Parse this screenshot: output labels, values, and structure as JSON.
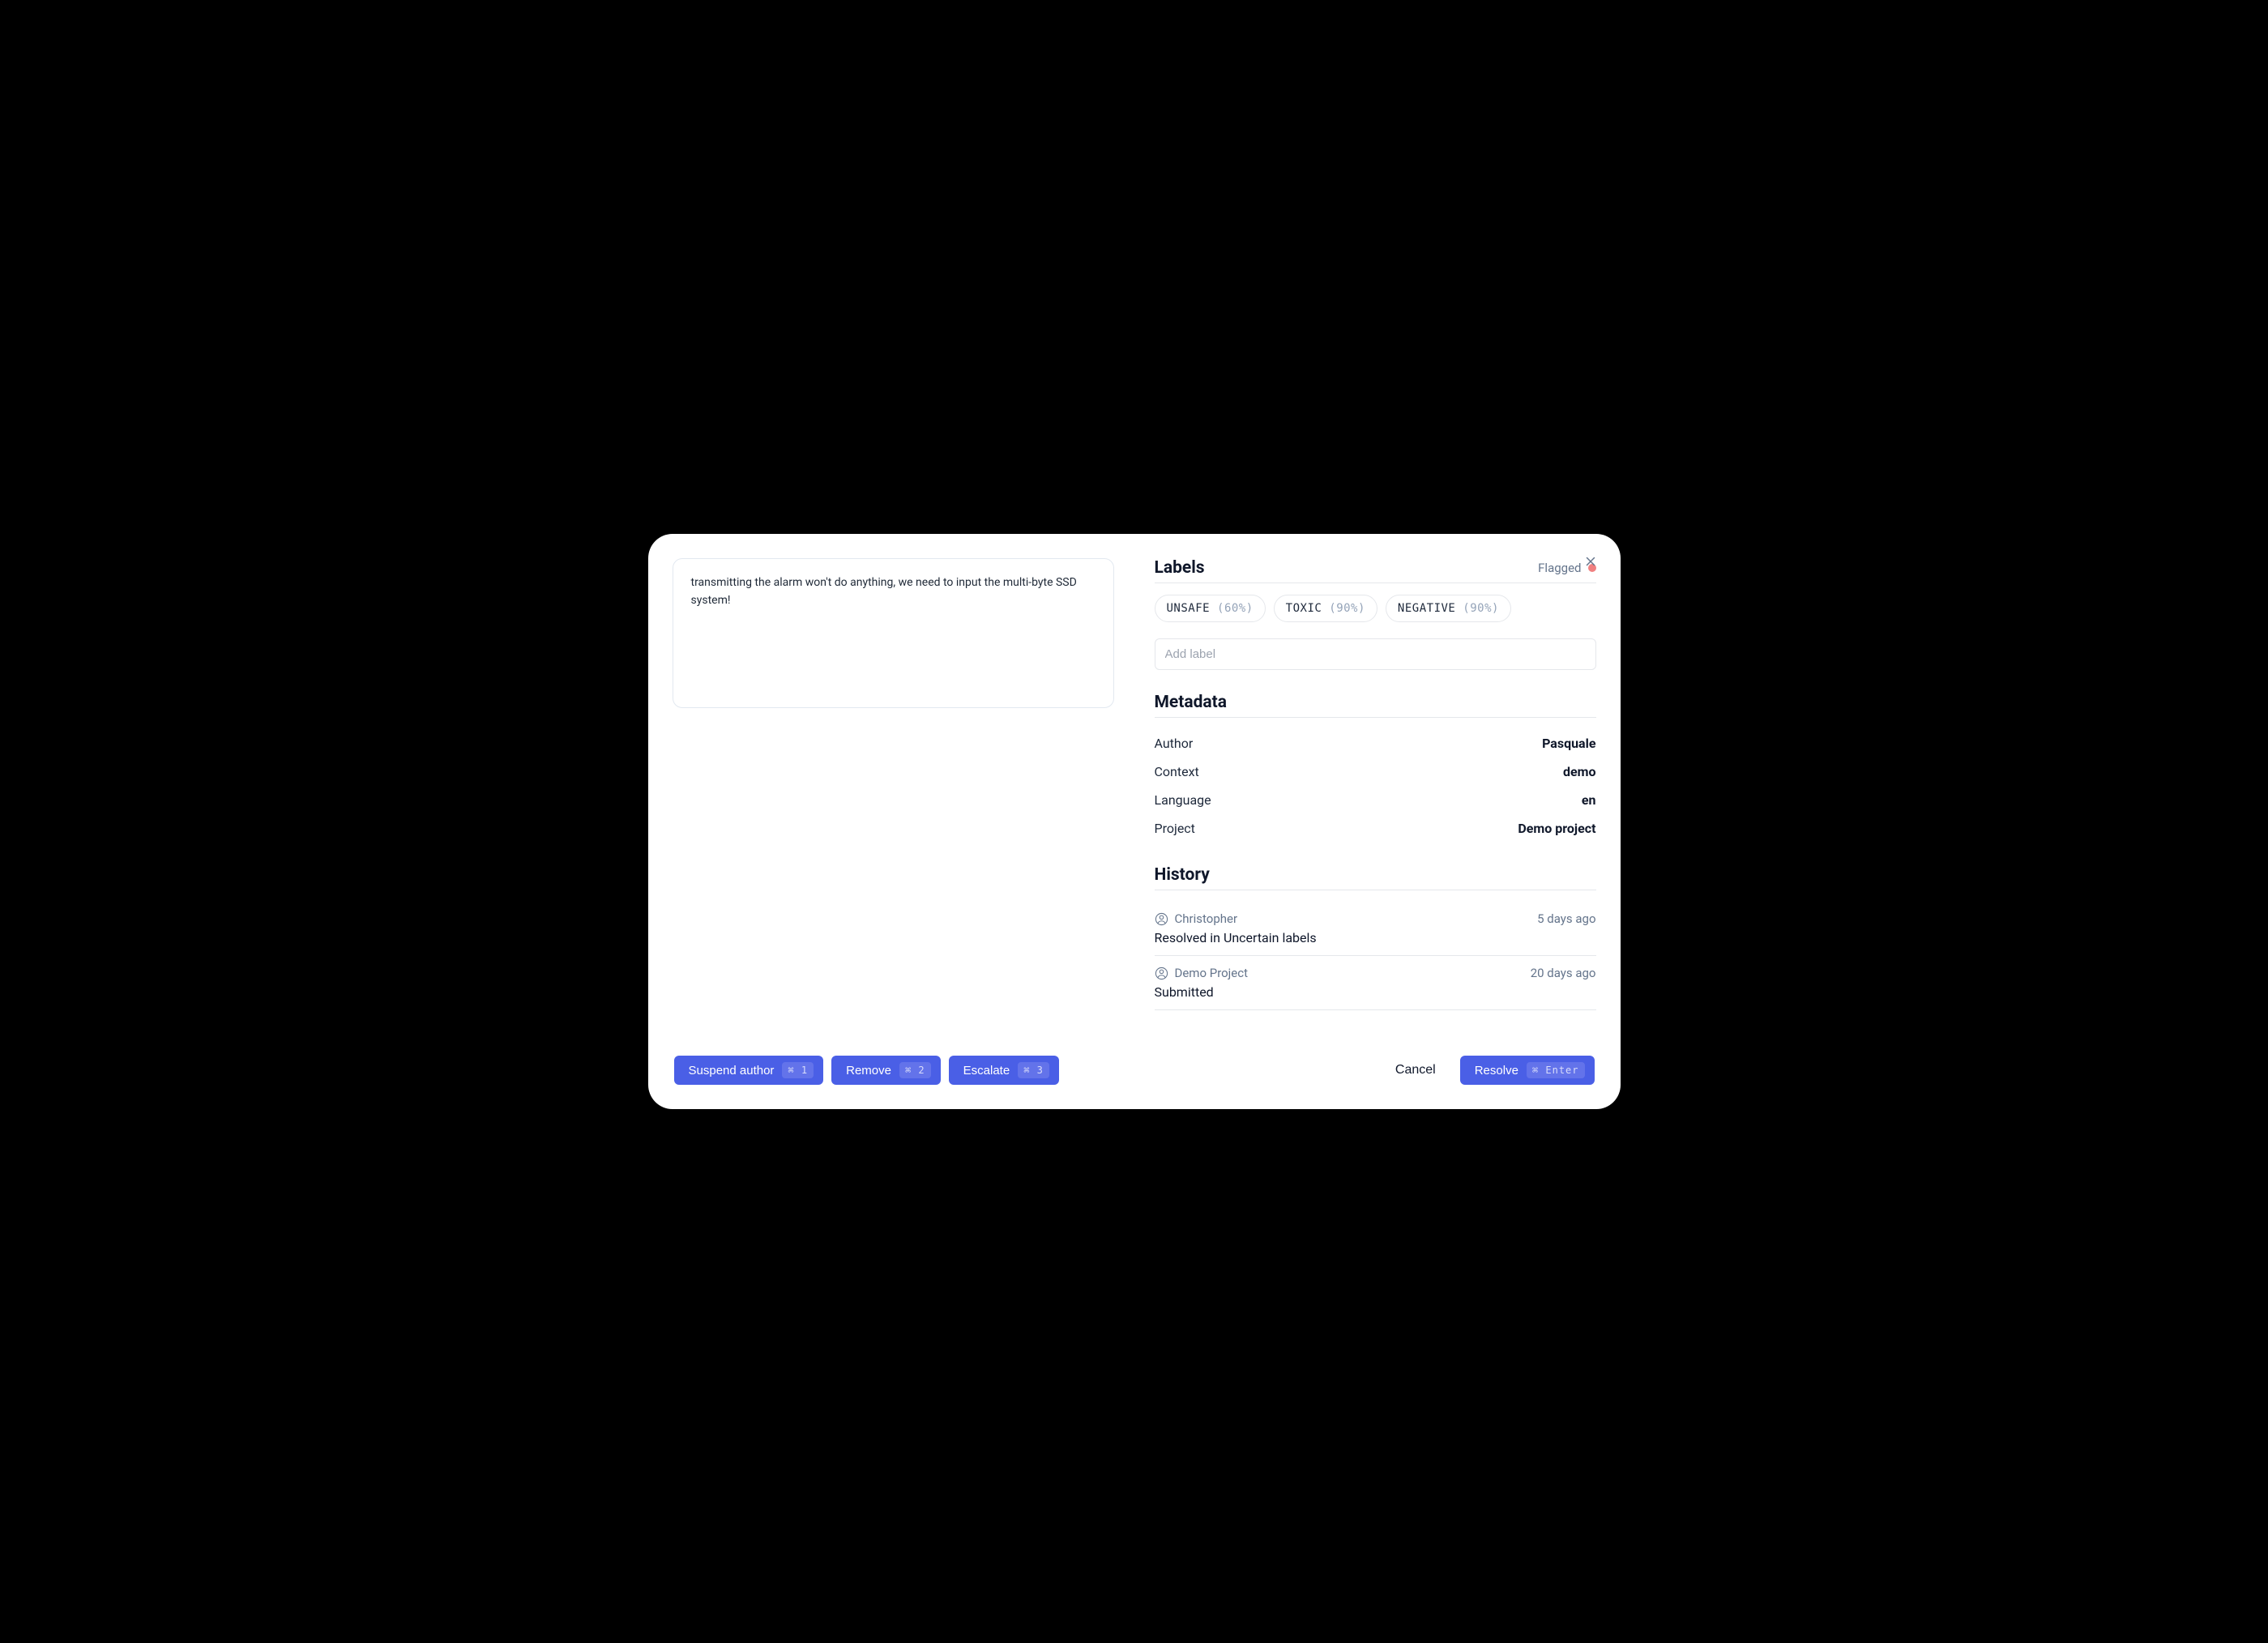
{
  "content_text": "transmitting the alarm won't do anything, we need to input the multi-byte SSD system!",
  "labels": {
    "title": "Labels",
    "status": "Flagged",
    "items": [
      {
        "name": "UNSAFE",
        "pct": "(60%)"
      },
      {
        "name": "TOXIC",
        "pct": "(90%)"
      },
      {
        "name": "NEGATIVE",
        "pct": "(90%)"
      }
    ],
    "add_placeholder": "Add label"
  },
  "metadata": {
    "title": "Metadata",
    "rows": [
      {
        "key": "Author",
        "val": "Pasquale"
      },
      {
        "key": "Context",
        "val": "demo"
      },
      {
        "key": "Language",
        "val": "en"
      },
      {
        "key": "Project",
        "val": "Demo project"
      }
    ]
  },
  "history": {
    "title": "History",
    "items": [
      {
        "user": "Christopher",
        "time": "5 days ago",
        "desc": "Resolved in Uncertain labels"
      },
      {
        "user": "Demo Project",
        "time": "20 days ago",
        "desc": "Submitted"
      }
    ]
  },
  "footer": {
    "left": [
      {
        "label": "Suspend author",
        "kbd": "⌘ 1"
      },
      {
        "label": "Remove",
        "kbd": "⌘ 2"
      },
      {
        "label": "Escalate",
        "kbd": "⌘ 3"
      }
    ],
    "cancel": "Cancel",
    "resolve": {
      "label": "Resolve",
      "kbd": "⌘ Enter"
    }
  }
}
